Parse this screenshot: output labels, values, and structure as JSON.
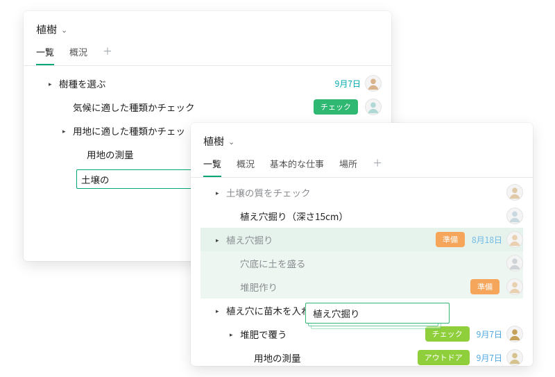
{
  "cardA": {
    "title": "植樹",
    "tabs": [
      "一覧",
      "概況"
    ],
    "activeTab": 0,
    "rows": [
      {
        "indent": 1,
        "tri": true,
        "label": "樹種を選ぶ",
        "date": "9月7日",
        "dateClass": "teal",
        "avatar": "a1"
      },
      {
        "indent": 2,
        "tri": false,
        "label": "気候に適した種類かチェック",
        "tag": "チェック",
        "tagClass": "green",
        "avatar": "a2"
      },
      {
        "indent": 2,
        "tri": true,
        "label": "用地に適した種類かチェッ",
        "avatar": null
      },
      {
        "indent": 3,
        "tri": false,
        "label": "用地の測量"
      },
      {
        "indent": 3,
        "input": true,
        "value": "土壌の"
      }
    ]
  },
  "cardB": {
    "title": "植樹",
    "tabs": [
      "一覧",
      "概況",
      "基本的な仕事",
      "場所"
    ],
    "activeTab": 0,
    "rows": [
      {
        "indent": 1,
        "tri": true,
        "dim": true,
        "label": "土壌の質をチェック",
        "avatar": "a5"
      },
      {
        "indent": 2,
        "tri": false,
        "label": "植え穴掘り（深さ15cm）",
        "avatar": "a6"
      },
      {
        "indent": 1,
        "tri": true,
        "dim": true,
        "sel": "sel1",
        "label": "植え穴掘り",
        "tag": "準備",
        "tagClass": "orange",
        "date": "8月18日",
        "dateClass": "sky",
        "avatar": "a7"
      },
      {
        "indent": 2,
        "tri": false,
        "dim": true,
        "sel": "sel2",
        "label": "穴底に土を盛る",
        "avatar": "a8"
      },
      {
        "indent": 2,
        "tri": false,
        "dim": true,
        "sel": "sel2",
        "label": "堆肥作り",
        "tag": "準備",
        "tagClass": "orange",
        "avatar": "a9"
      },
      {
        "indent": 1,
        "tri": true,
        "label": "植え穴に苗木を入れる"
      },
      {
        "indent": 2,
        "tri": true,
        "label": "堆肥で覆う",
        "tag": "チェック",
        "tagClass": "lime",
        "date": "9月7日",
        "dateClass": "blue",
        "avatar": "a10"
      },
      {
        "indent": 3,
        "tri": false,
        "label": "用地の測量",
        "tag": "アウトドア",
        "tagClass": "lime",
        "date": "9月7日",
        "dateClass": "blue",
        "avatar": "a11"
      }
    ],
    "dragLabel": "植え穴掘り"
  },
  "icons": {
    "add": "＋",
    "chev": "⌄"
  },
  "avatarColors": {
    "a1": "#d9b38c",
    "a2": "#b0d9d6",
    "a5": "#e0c9a6",
    "a6": "#c9d9e0",
    "a7": "#e8d0b0",
    "a8": "#cfd2d6",
    "a9": "#e8d0b0",
    "a10": "#c6a15b",
    "a11": "#d6c28f"
  }
}
